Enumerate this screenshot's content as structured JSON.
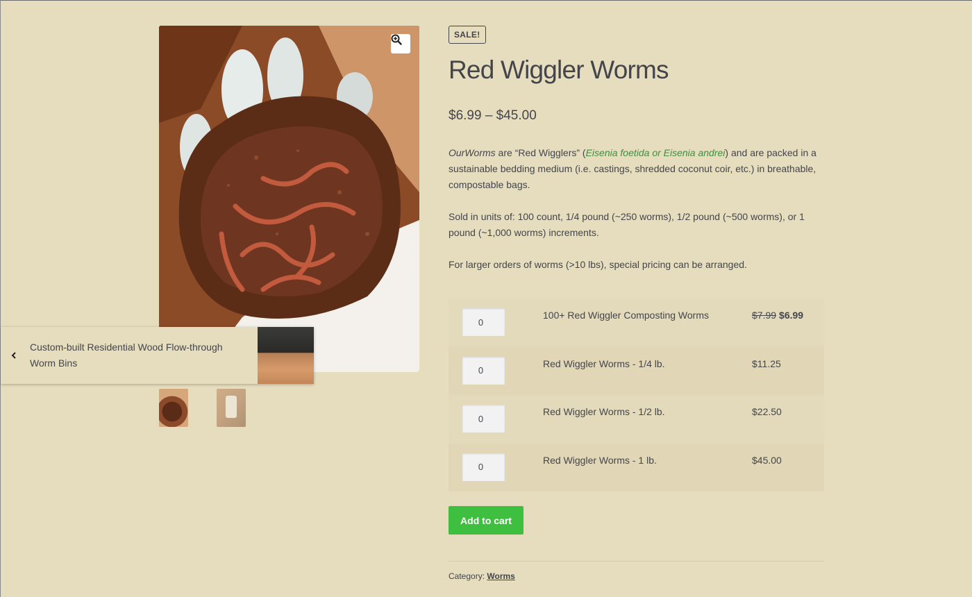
{
  "gallery": {
    "main_image_alt": "Red wiggler worms in compost held in a gloved hand",
    "zoom_icon": "zoom-in-icon",
    "thumbnails": [
      {
        "name": "worms-in-hand"
      },
      {
        "name": "worm-bag"
      }
    ]
  },
  "prev_product": {
    "title": "Custom-built Residential Wood Flow-through Worm Bins",
    "icon": "chevron-left-icon"
  },
  "product": {
    "badge": "SALE!",
    "title": "Red Wiggler Worms",
    "price_range": "$6.99 – $45.00",
    "description": {
      "p1_brand": "OurWorms",
      "p1_a": " are “Red Wigglers” (",
      "p1_species": "Eisenia foetida or Eisenia andrei",
      "p1_b": ") and are packed in a sustainable bedding medium (i.e. castings, shredded coconut coir, etc.) in breathable, compostable bags.",
      "p2": "Sold in units of: 100 count, 1/4 pound (~250 worms), 1/2 pound (~500 worms), or 1 pound (~1,000 worms) increments.",
      "p3": "For larger orders of worms (>10 lbs), special pricing  can be arranged."
    },
    "variants": [
      {
        "qty": "0",
        "name": "100+ Red Wiggler Composting Worms",
        "old_price": "$7.99",
        "price": "$6.99"
      },
      {
        "qty": "0",
        "name": "Red Wiggler Worms - 1/4 lb.",
        "price": "$11.25"
      },
      {
        "qty": "0",
        "name": "Red Wiggler Worms - 1/2 lb.",
        "price": "$22.50"
      },
      {
        "qty": "0",
        "name": "Red Wiggler Worms - 1 lb.",
        "price": "$45.00"
      }
    ],
    "add_to_cart": "Add to cart",
    "category_label": "Category:",
    "category": "Worms"
  },
  "colors": {
    "background": "#e6dcbe",
    "text": "#43454b",
    "button": "#3fbf3f",
    "species_link": "#3f8f3f"
  }
}
